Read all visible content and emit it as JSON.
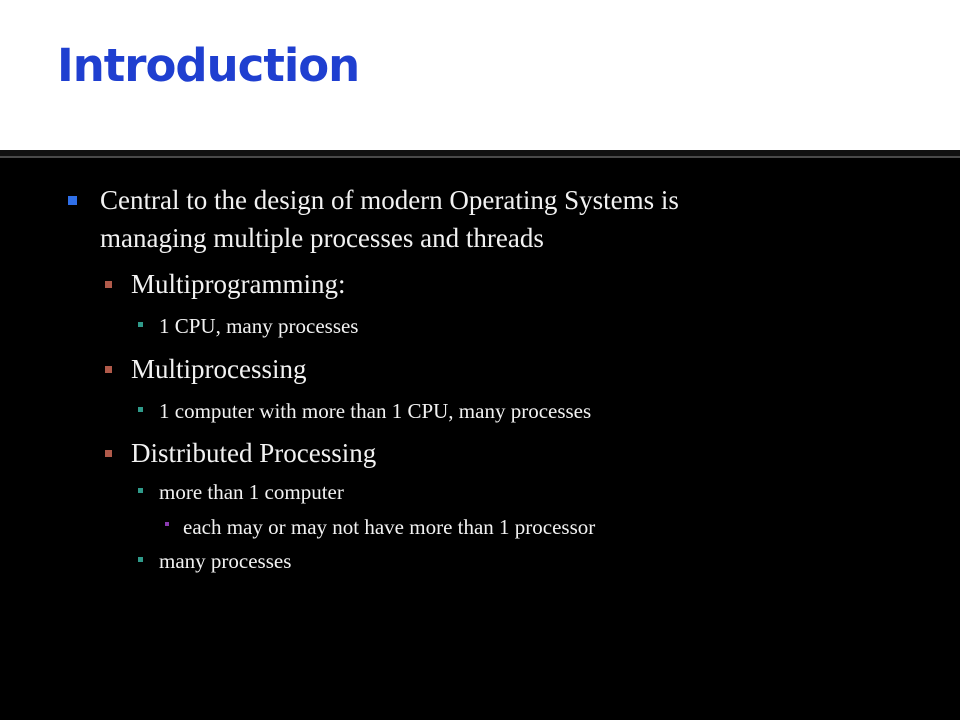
{
  "slide": {
    "title": "Introduction",
    "bullets": [
      {
        "level": 1,
        "text_line1": "Central to the design of modern Operating Systems is",
        "text_line2": "managing multiple processes and threads"
      },
      {
        "level": 2,
        "text": "Multiprogramming:"
      },
      {
        "level": 3,
        "text": "1 CPU, many processes"
      },
      {
        "level": 2,
        "text": "Multiprocessing"
      },
      {
        "level": 3,
        "text": "1 computer with more than 1 CPU, many processes"
      },
      {
        "level": 2,
        "text": "Distributed Processing"
      },
      {
        "level": 3,
        "text": "more than 1 computer"
      },
      {
        "level": 4,
        "text": "each may or may not have more than 1 processor"
      },
      {
        "level": 3,
        "text": "many processes"
      }
    ]
  },
  "colors": {
    "title": "#1f3fd0",
    "title_background": "#ffffff",
    "slide_background": "#000000",
    "text": "#f2f2f2",
    "bullet_level1": "#2f6fe8",
    "bullet_level2": "#b05a4a",
    "bullet_level3": "#2f9a8a",
    "bullet_level4": "#8a3ab0"
  }
}
